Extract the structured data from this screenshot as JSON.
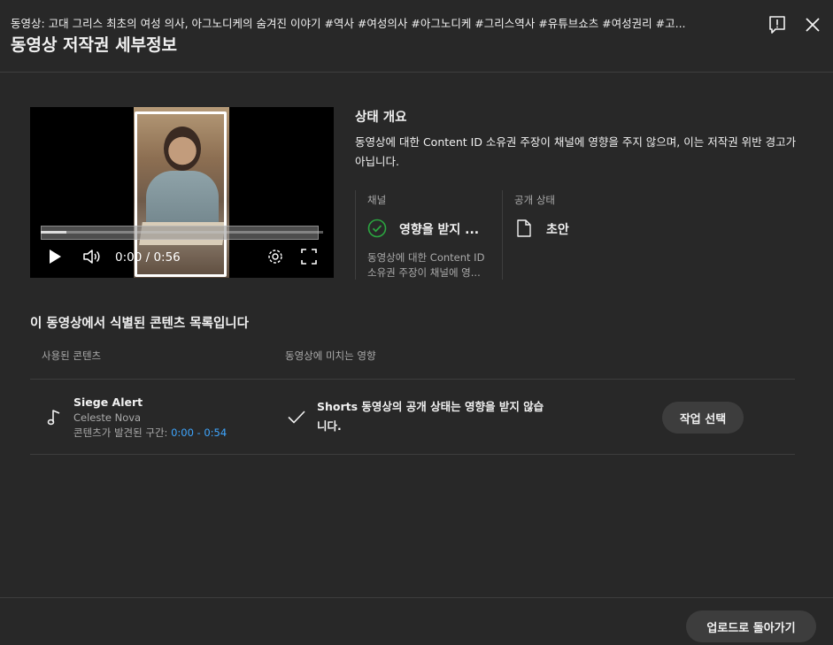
{
  "header": {
    "subtitle": "동영상: 고대 그리스 최초의 여성 의사, 아그노디케의 숨겨진 이야기 #역사 #여성의사 #아그노디케 #그리스역사 #유튜브쇼츠 #여성권리 #고...",
    "title": "동영상 저작권 세부정보",
    "icons": [
      "feedback-icon",
      "close-icon"
    ]
  },
  "player": {
    "time": "0:00 / 0:56",
    "progress_fraction": 0.09,
    "icons": [
      "play-icon",
      "volume-icon",
      "settings-icon",
      "fullscreen-icon"
    ]
  },
  "status": {
    "title": "상태 개요",
    "description": "동영상에 대한 Content ID 소유권 주장이 채널에 영향을 주지 않으며, 이는 저작권 위반 경고가 아닙니다.",
    "channel": {
      "label": "채널",
      "value": "영향을 받지 ...",
      "note_line1": "동영상에 대한 Content ID",
      "note_line2": "소유권 주장이 채널에 영...",
      "icon": "check-circle-icon",
      "color": "#2ba640"
    },
    "visibility": {
      "label": "공개 상태",
      "value": "초안",
      "icon": "document-icon"
    }
  },
  "content_list": {
    "title": "이 동영상에서 식별된 콘텐츠 목록입니다",
    "headers": [
      "사용된 콘텐츠",
      "동영상에 미치는 영향"
    ],
    "items": [
      {
        "name": "Siege Alert",
        "artist": "Celeste Nova",
        "range_label": "콘텐츠가 발견된 구간: ",
        "range": "0:00 - 0:54",
        "impact": "Shorts 동영상의 공개 상태는 영향을 받지 않습니다.",
        "action": "작업 선택",
        "icon": "music-note-icon"
      }
    ]
  },
  "footer": {
    "back_button": "업로드로 돌아가기"
  },
  "colors": {
    "background": "#282828",
    "link": "#3ea6ff",
    "button": "#3d3d3d"
  }
}
